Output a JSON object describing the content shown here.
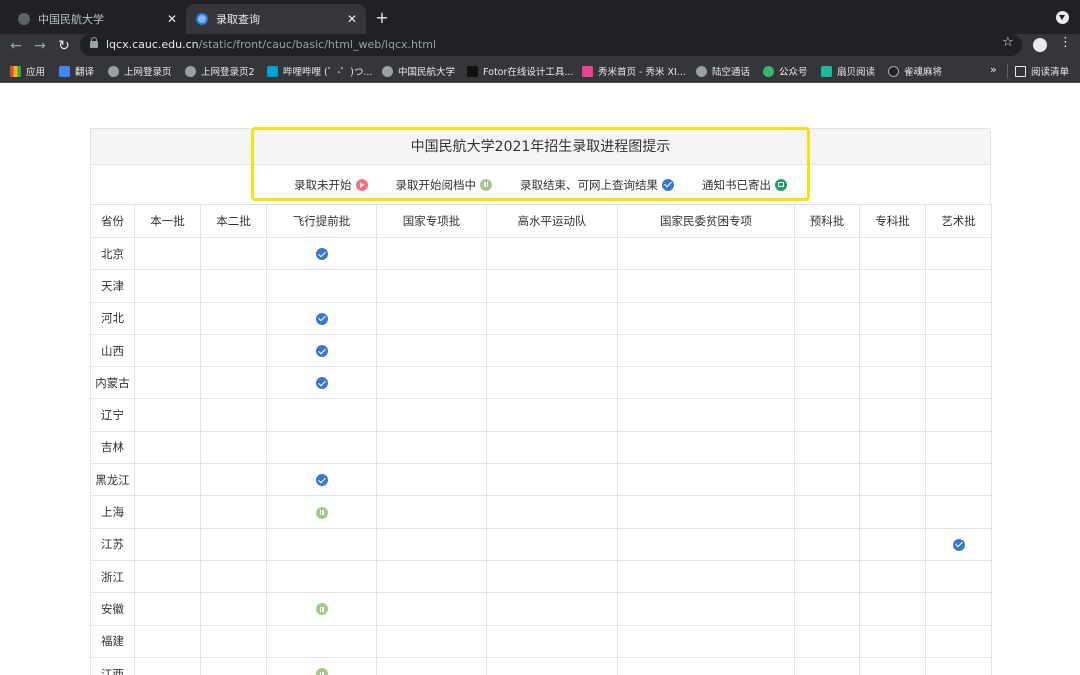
{
  "browser": {
    "tabs": [
      {
        "title": "中国民航大学",
        "close": "✕"
      },
      {
        "title": "录取查询",
        "close": "✕"
      }
    ],
    "new_tab": "+",
    "url_host": "lqcx.cauc.edu.cn",
    "url_path": "/static/front/cauc/basic/html_web/lqcx.html",
    "bookmarks": [
      {
        "label": "应用",
        "icon": "apps-grid-icon"
      },
      {
        "label": "翻译",
        "icon": "translate-icon"
      },
      {
        "label": "上网登录页",
        "icon": "globe-icon"
      },
      {
        "label": "上网登录页2",
        "icon": "globe-icon"
      },
      {
        "label": "哔哩哔哩 (゜-゜)つ...",
        "icon": "bilibili-icon"
      },
      {
        "label": "中国民航大学",
        "icon": "globe-icon"
      },
      {
        "label": "Fotor在线设计工具...",
        "icon": "fotor-icon"
      },
      {
        "label": "秀米首页 - 秀米 XI...",
        "icon": "xiumi-icon"
      },
      {
        "label": "陆空通话",
        "icon": "globe-icon"
      },
      {
        "label": "公众号",
        "icon": "wechat-icon"
      },
      {
        "label": "扇贝阅读",
        "icon": "shanbay-icon"
      },
      {
        "label": "雀魂麻将",
        "icon": "mahjong-icon"
      }
    ],
    "bookmarks_more": "»",
    "reading_list": "阅读清单"
  },
  "page": {
    "title": "中国民航大学2021年招生录取进程图提示",
    "legend": [
      {
        "label": "录取未开始",
        "status": "notstarted"
      },
      {
        "label": "录取开始阅档中",
        "status": "review"
      },
      {
        "label": "录取结束、可网上查询结果",
        "status": "done"
      },
      {
        "label": "通知书已寄出",
        "status": "mailed"
      }
    ],
    "columns": [
      "省份",
      "本一批",
      "本二批",
      "飞行提前批",
      "国家专项批",
      "高水平运动队",
      "国家民委贫困专项",
      "预科批",
      "专科批",
      "艺术批"
    ],
    "rows": [
      {
        "province": "北京",
        "flight": "done",
        "art": ""
      },
      {
        "province": "天津",
        "flight": "",
        "art": ""
      },
      {
        "province": "河北",
        "flight": "done",
        "art": ""
      },
      {
        "province": "山西",
        "flight": "done",
        "art": ""
      },
      {
        "province": "内蒙古",
        "flight": "done",
        "art": ""
      },
      {
        "province": "辽宁",
        "flight": "",
        "art": ""
      },
      {
        "province": "吉林",
        "flight": "",
        "art": ""
      },
      {
        "province": "黑龙江",
        "flight": "done",
        "art": ""
      },
      {
        "province": "上海",
        "flight": "review",
        "art": ""
      },
      {
        "province": "江苏",
        "flight": "",
        "art": "done"
      },
      {
        "province": "浙江",
        "flight": "",
        "art": ""
      },
      {
        "province": "安徽",
        "flight": "review",
        "art": ""
      },
      {
        "province": "福建",
        "flight": "",
        "art": ""
      },
      {
        "province": "江西",
        "flight": "review",
        "art": ""
      }
    ]
  },
  "colors": {
    "highlight": "#f7e10f",
    "done": "#3a78c9",
    "review": "#a6c78a",
    "notstarted": "#f0717a",
    "mailed": "#1fa060"
  }
}
